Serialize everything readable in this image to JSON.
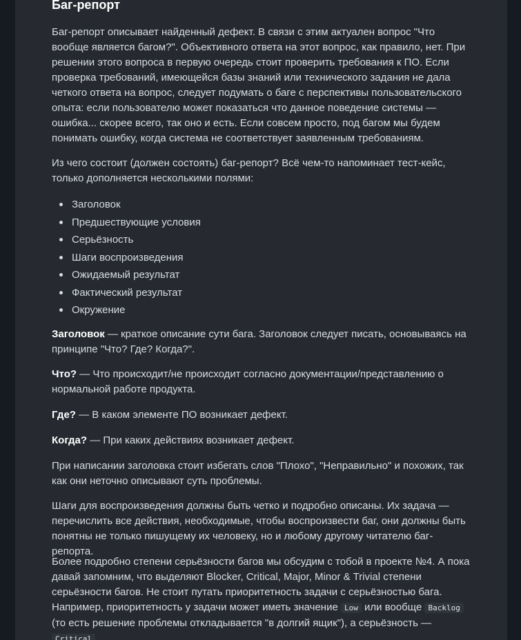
{
  "section": {
    "title": "Баг-репорт"
  },
  "p1": "Баг-репорт описывает найденный дефект. В связи с этим актуален вопрос \"Что вообще является багом?\". Объективного ответа на этот вопрос, как правило, нет. При решении этого вопроса в первую очередь стоит проверить требования к ПО. Если проверка требований, имеющейся базы знаний или технического задания не дала четкого ответа на вопрос, следует подумать о баге с перспективы пользовательского опыта: если пользователю может показаться что данное поведение системы — ошибка... скорее всего, так оно и есть. Если совсем просто, под багом мы будем понимать ошибку, когда система не соответствует заявленным требованиям.",
  "p2": "Из чего состоит (должен состоять) баг-репорт? Всё чем-то напоминает тест-кейс, только дополняется несколькими полями:",
  "fields": [
    "Заголовок",
    "Предшествующие условия",
    "Серьёзность",
    "Шаги воспроизведения",
    "Ожидаемый результат",
    "Фактический результат",
    "Окружение"
  ],
  "title_def": {
    "term": "Заголовок",
    "text": " — краткое описание сути бага. Заголовок следует писать, основываясь на принципе \"Что? Где? Когда?\"."
  },
  "what": {
    "term": "Что?",
    "text": " — Что происходит/не происходит согласно документации/представлению о нормальной работе продукта."
  },
  "where": {
    "term": "Где?",
    "text": " — В каком элементе ПО возникает дефект."
  },
  "when": {
    "term": "Когда?",
    "text": " — При каких действиях возникает дефект."
  },
  "p_avoid": "При написании заголовка стоит избегать слов \"Плохо\", \"Неправильно\" и похожих, так как они неточно описывают суть проблемы.",
  "p_steps": "Шаги для воспроизведения должны быть четко и подробно описаны. Их задача — перечислить все действия, необходимые, чтобы воспроизвести баг, они должны быть понятны не только пишущему их человеку, но и любому другому читателю баг-репорта.",
  "p_severity": {
    "part1": "Более подробно степени серьёзности багов мы обсудим с тобой в проекте №4. А пока давай запомним, что выделяют Blocker, Critical, Major, Minor & Trivial степени серьёзности багов. Не стоит путать приоритетность задачи с серьёзностью бага. Например, приоритетность у задачи может иметь значение ",
    "code1": "Low",
    "part2": " или вообще ",
    "code2": "Backlog",
    "part3": " (то есть решение проблемы откладывается \"в долгий ящик\"), а серьёзность — ",
    "code3": "Critical",
    "part4": " ."
  }
}
